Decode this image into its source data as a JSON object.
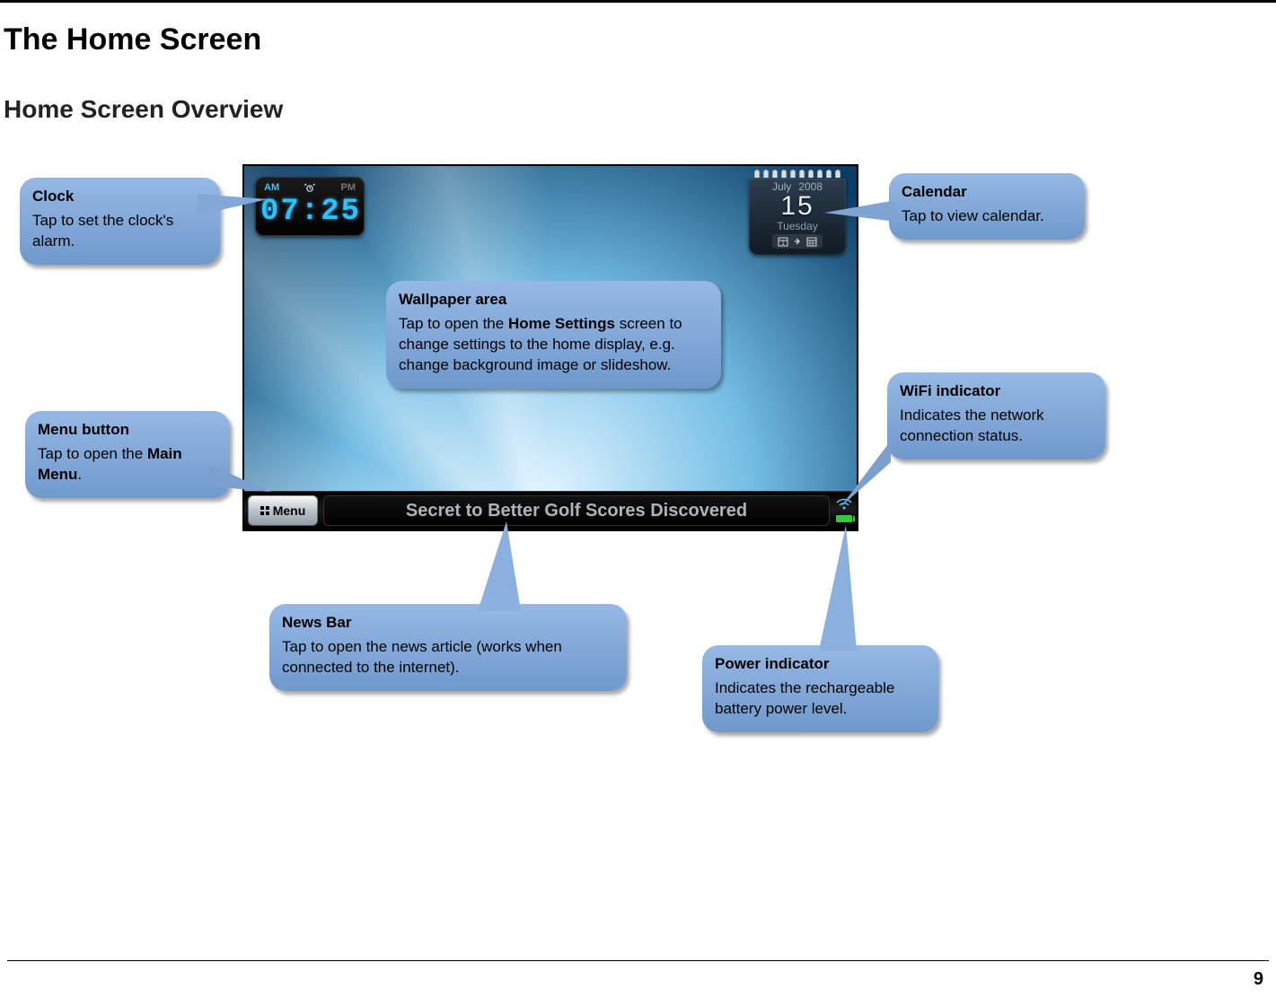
{
  "heading1": "The Home Screen",
  "heading2": "Home Screen Overview",
  "page_number": "9",
  "device": {
    "clock": {
      "am_label": "AM",
      "pm_label": "PM",
      "time": "07:25"
    },
    "calendar": {
      "month": "July",
      "year": "2008",
      "day_num": "15",
      "day_name": "Tuesday"
    },
    "taskbar": {
      "menu_label": "Menu",
      "news_headline": "Secret to Better Golf Scores Discovered"
    }
  },
  "callouts": {
    "clock": {
      "title": "Clock",
      "body": "Tap to set the clock's alarm."
    },
    "calendar": {
      "title": "Calendar",
      "body": "Tap to view calendar."
    },
    "wallpaper": {
      "title": "Wallpaper area",
      "body_pre": "Tap to open the ",
      "body_bold": "Home Settings",
      "body_post": " screen to change settings to the home display, e.g. change background image or slideshow."
    },
    "menu": {
      "title": "Menu button",
      "body_pre": "Tap to open the ",
      "body_bold": "Main Menu",
      "body_post": "."
    },
    "wifi": {
      "title": "WiFi indicator",
      "body": "Indicates the network connection status."
    },
    "news": {
      "title": "News Bar",
      "body": "Tap to open the news article (works when connected to the internet)."
    },
    "power": {
      "title": "Power indicator",
      "body": "Indicates the rechargeable battery power level."
    }
  }
}
